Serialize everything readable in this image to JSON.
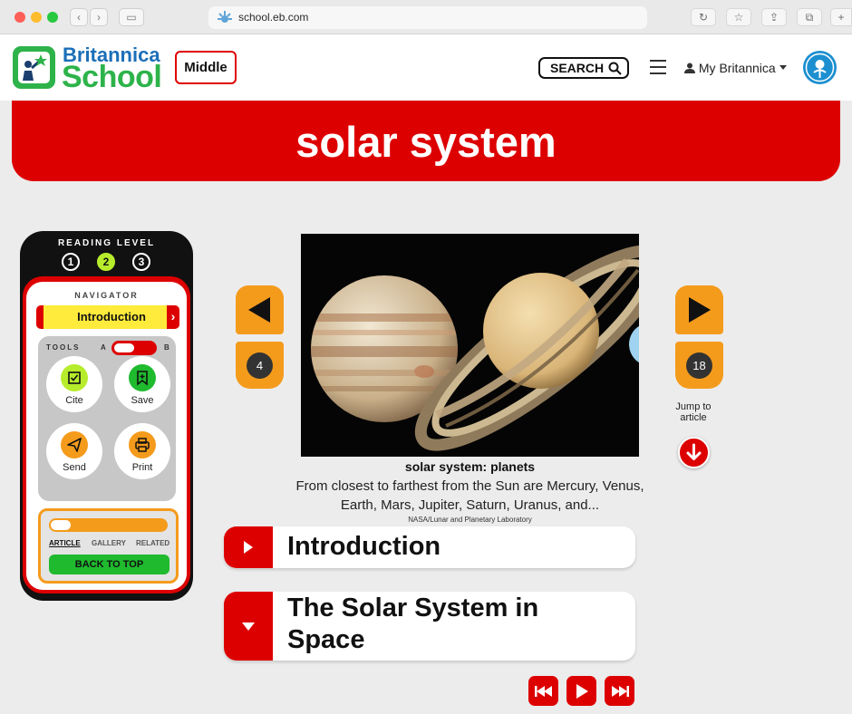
{
  "browser": {
    "url": "school.eb.com"
  },
  "header": {
    "logo_line1": "Britannica",
    "logo_line2": "School",
    "level_badge": "Middle",
    "search_label": "SEARCH",
    "account_label": "My Britannica"
  },
  "article": {
    "title": "solar system"
  },
  "toolbox": {
    "reading_level_label": "READING LEVEL",
    "reading_levels": [
      "1",
      "2",
      "3"
    ],
    "active_level": "2",
    "navigator_label": "NAVIGATOR",
    "navigator_selected": "Introduction",
    "tools_label": "TOOLS",
    "toggle_a": "A",
    "toggle_b": "B",
    "tools": [
      {
        "label": "Cite"
      },
      {
        "label": "Save"
      },
      {
        "label": "Send"
      },
      {
        "label": "Print"
      }
    ],
    "section_tabs": [
      "ARTICLE",
      "GALLERY",
      "RELATED"
    ],
    "back_to_top": "BACK TO TOP"
  },
  "gallery": {
    "prev_count": "4",
    "next_count": "18",
    "caption_title": "solar system: planets",
    "caption_text": "From closest to farthest from the Sun are Mercury, Venus, Earth, Mars, Jupiter, Saturn, Uranus, and...",
    "credit": "NASA/Lunar and Planetary Laboratory",
    "jump_label": "Jump to article"
  },
  "sections": [
    {
      "title": "Introduction"
    },
    {
      "title": "The Solar System in Space"
    }
  ],
  "colors": {
    "brand_red": "#dd0000",
    "brand_green": "#2db34a",
    "accent_orange": "#f49b1c",
    "highlight_yellow": "#ffeb3b"
  }
}
